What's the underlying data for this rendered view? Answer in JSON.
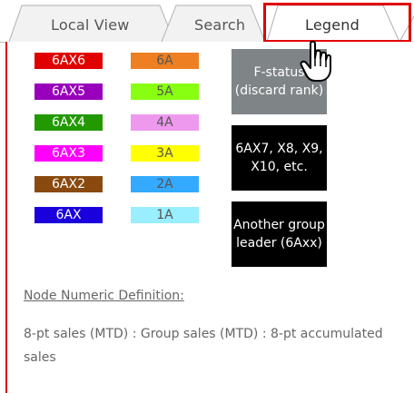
{
  "tabs": [
    {
      "label": "Local View",
      "active": false
    },
    {
      "label": "Search",
      "active": false
    },
    {
      "label": "Legend",
      "active": true
    }
  ],
  "legend": {
    "left_chips": [
      {
        "label": "6AX6",
        "bg": "#e00000",
        "fg": "#ffffff"
      },
      {
        "label": "6AX5",
        "bg": "#9900bb",
        "fg": "#ffffff"
      },
      {
        "label": "6AX4",
        "bg": "#229900",
        "fg": "#ffffff"
      },
      {
        "label": "6AX3",
        "bg": "#ff00ff",
        "fg": "#ffffff"
      },
      {
        "label": "6AX2",
        "bg": "#8a4a0f",
        "fg": "#ffffff"
      },
      {
        "label": "6AX",
        "bg": "#1a00dd",
        "fg": "#ffffff"
      }
    ],
    "right_chips": [
      {
        "label": "6A",
        "bg": "#ee7f22",
        "fg": "#555555"
      },
      {
        "label": "5A",
        "bg": "#88ff11",
        "fg": "#555555"
      },
      {
        "label": "4A",
        "bg": "#ee99ee",
        "fg": "#555555"
      },
      {
        "label": "3A",
        "bg": "#ffff00",
        "fg": "#555555"
      },
      {
        "label": "2A",
        "bg": "#33aaff",
        "fg": "#555555"
      },
      {
        "label": "1A",
        "bg": "#99eeff",
        "fg": "#555555"
      }
    ],
    "fstatus": {
      "line1": "F-status",
      "line2": "(discard rank)",
      "bg": "#7f8486"
    },
    "higher": {
      "line1": "6AX7, X8, X9,",
      "line2": "X10, etc.",
      "bg": "#000000"
    },
    "group_leader": {
      "line1": "Another group",
      "line2": "leader (6Axx)",
      "bg": "#000000"
    }
  },
  "definition": {
    "title": "Node Numeric Definition:",
    "text": "8-pt sales (MTD) : Group sales (MTD) : 8-pt accumulated sales"
  },
  "colors": {
    "accent": "#e00000"
  },
  "icons": {
    "cursor": "hand-pointer-icon"
  }
}
